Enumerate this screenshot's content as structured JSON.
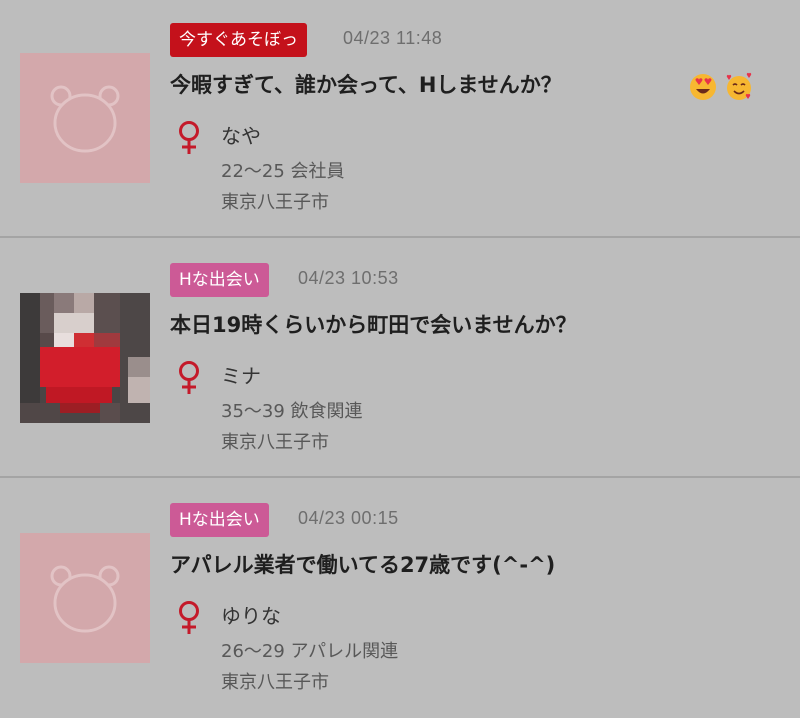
{
  "colors": {
    "background": "#bdbdbd",
    "tag_red": "#c4111b",
    "tag_pink": "#cc5a96",
    "gender_female": "#c41a2a",
    "avatar_placeholder": "#d3a8ab"
  },
  "posts": [
    {
      "tag": "今すぐあそぼっ",
      "tag_color": "#c4111b",
      "datetime": "04/23 11:48",
      "title": "今暇すぎて、誰か会って、Hしませんか？",
      "emojis": [
        "smiling-face-with-heart-eyes-icon",
        "smiling-face-with-hearts-icon"
      ],
      "gender_icon": "female-symbol-icon",
      "name": "なや",
      "age_job": "22～25 会社員",
      "location": "東京八王子市",
      "avatar": "placeholder-bear-icon"
    },
    {
      "tag": "Hな出会い",
      "tag_color": "#cc5a96",
      "datetime": "04/23 10:53",
      "title": "本日19時くらいから町田で会いませんか？",
      "emojis": [],
      "gender_icon": "female-symbol-icon",
      "name": "ミナ",
      "age_job": "35～39 飲食関連",
      "location": "東京八王子市",
      "avatar": "mosaic-photo"
    },
    {
      "tag": "Hな出会い",
      "tag_color": "#cc5a96",
      "datetime": "04/23 00:15",
      "title": "アパレル業者で働いてる27歳です(^-^)",
      "emojis": [],
      "gender_icon": "female-symbol-icon",
      "name": "ゆりな",
      "age_job": "26～29 アパレル関連",
      "location": "東京八王子市",
      "avatar": "placeholder-bear-icon"
    }
  ]
}
